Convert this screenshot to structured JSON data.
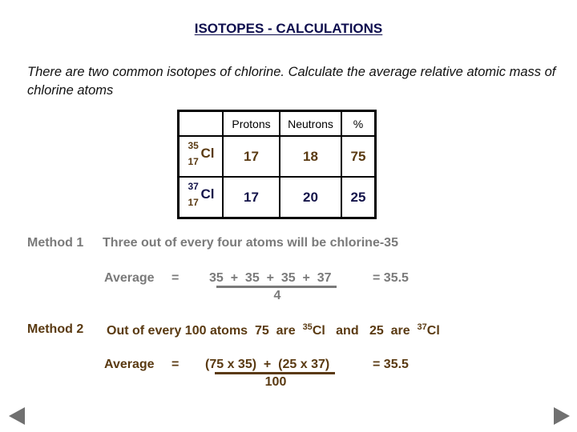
{
  "title": "ISOTOPES - CALCULATIONS",
  "intro": "There are two common isotopes of chlorine. Calculate the average relative atomic mass of chlorine atoms",
  "table": {
    "headers": [
      "",
      "Protons",
      "Neutrons",
      "%"
    ],
    "rows": [
      {
        "mass_number": "35",
        "atomic_number": "17",
        "symbol": "Cl",
        "protons": "17",
        "neutrons": "18",
        "percent": "75",
        "color": "#5a3a12"
      },
      {
        "mass_number": "37",
        "atomic_number": "17",
        "symbol": "Cl",
        "protons": "17",
        "neutrons": "20",
        "percent": "25",
        "color": "#14144a"
      }
    ]
  },
  "method1": {
    "label": "Method 1",
    "description": "Three out of every four atoms will be chlorine-35",
    "average_label": "Average",
    "equals": "=",
    "numerator": "35  +  35  +  35  +  37",
    "denominator": "4",
    "result": "= 35.5",
    "color": "#7a7a7a"
  },
  "method2": {
    "label": "Method 2",
    "description_part1": "Out of every 100 atoms  75  are",
    "sup1": "35",
    "symbol1": "Cl",
    "description_part2": "and   25  are",
    "sup2": "37",
    "symbol2": "Cl",
    "average_label": "Average",
    "equals": "=",
    "numerator": "(75 x 35)  +  (25 x 37)",
    "denominator": "100",
    "result": "= 35.5",
    "color": "#5a3a12"
  },
  "nav": {
    "prev_icon": "triangle-left",
    "next_icon": "triangle-right"
  }
}
